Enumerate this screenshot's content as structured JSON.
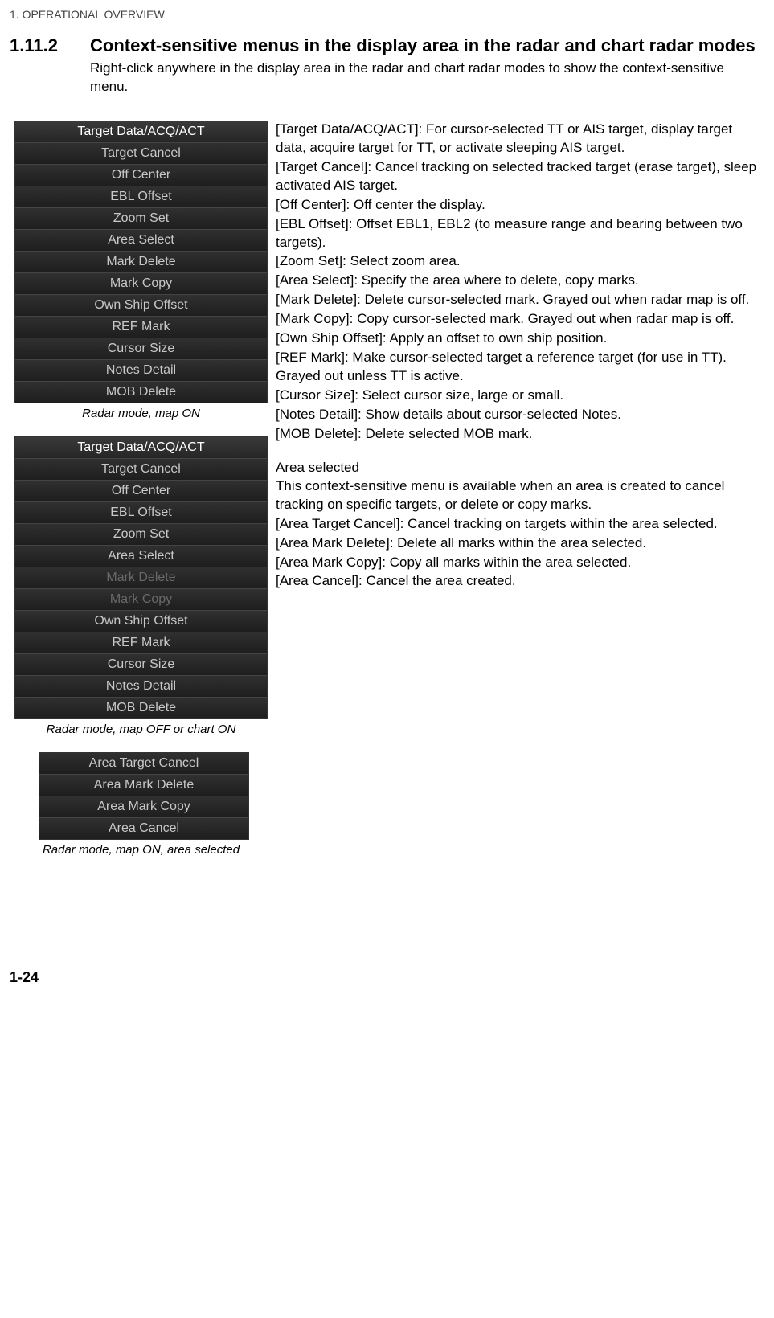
{
  "chapter": "1.  OPERATIONAL OVERVIEW",
  "section_number": "1.11.2",
  "section_title": "Context-sensitive menus in the display area in the radar and chart radar modes",
  "intro": "Right-click anywhere in the display area in the radar and chart radar modes to show the context-sensitive menu.",
  "menu1": {
    "items": [
      "Target Data/ACQ/ACT",
      "Target Cancel",
      "Off Center",
      "EBL Offset",
      "Zoom Set",
      "Area Select",
      "Mark Delete",
      "Mark Copy",
      "Own Ship Offset",
      "REF Mark",
      "Cursor Size",
      "Notes Detail",
      "MOB Delete"
    ],
    "caption": "Radar mode, map ON"
  },
  "menu2": {
    "items": [
      "Target Data/ACQ/ACT",
      "Target Cancel",
      "Off Center",
      "EBL Offset",
      "Zoom Set",
      "Area Select",
      "Mark Delete",
      "Mark Copy",
      "Own Ship Offset",
      "REF Mark",
      "Cursor Size",
      "Notes Detail",
      "MOB Delete"
    ],
    "dim": [
      6,
      7
    ],
    "caption": "Radar mode, map OFF or chart ON"
  },
  "menu3": {
    "items": [
      "Area Target Cancel",
      "Area Mark Delete",
      "Area Mark Copy",
      "Area Cancel"
    ],
    "caption": "Radar mode, map ON, area selected"
  },
  "descriptions": [
    "[Target Data/ACQ/ACT]: For cursor-selected TT or AIS target, display target data, acquire target for TT, or activate sleeping AIS target.",
    "[Target Cancel]: Cancel tracking on selected tracked target (erase target), sleep activated AIS target.",
    "[Off Center]: Off center the display.",
    "[EBL Offset]: Offset EBL1, EBL2 (to measure range and bearing between two targets).",
    "[Zoom Set]: Select zoom area.",
    "[Area Select]: Specify the area where to delete, copy marks.",
    "[Mark Delete]: Delete cursor-selected mark. Grayed out when radar map is off.",
    "[Mark Copy]: Copy cursor-selected mark. Grayed out when radar map is off.",
    "[Own Ship Offset]: Apply an offset to own ship position.",
    "[REF Mark]: Make cursor-selected target a reference target (for use in TT). Grayed out unless TT is active.",
    "[Cursor Size]: Select cursor size, large or small.",
    "[Notes Detail]: Show details about cursor-selected Notes.",
    "[MOB Delete]: Delete selected MOB mark."
  ],
  "area_heading": "Area selected",
  "area_intro": "This context-sensitive menu is available when an area is created to cancel tracking on specific targets, or delete or copy marks.",
  "area_descriptions": [
    "[Area Target Cancel]: Cancel tracking on targets within the area selected.",
    "[Area Mark Delete]: Delete all marks within the area selected.",
    "[Area Mark Copy]: Copy all marks within the area selected.",
    "[Area Cancel]: Cancel the area created."
  ],
  "page_number": "1-24"
}
